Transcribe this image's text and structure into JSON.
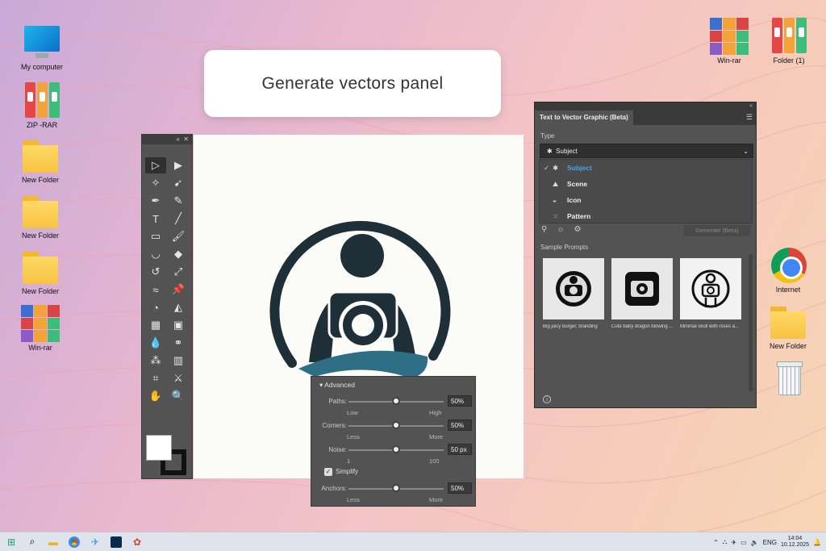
{
  "callout": {
    "text": "Generate vectors panel"
  },
  "desktop": {
    "my_computer": "My computer",
    "zip_rar": "ZIP -RAR",
    "new_folder_1": "New Folder",
    "new_folder_2": "New Folder",
    "new_folder_3": "New Folder",
    "winrar_left": "Win-rar",
    "winrar_right": "Win-rar",
    "folder_1": "Folder (1)",
    "internet": "Internet",
    "new_folder_right": "New Folder"
  },
  "advanced": {
    "title": "Advanced",
    "paths": {
      "label": "Paths:",
      "value": "50%",
      "low": "Low",
      "high": "High",
      "level": 0.5
    },
    "corners": {
      "label": "Corners:",
      "value": "50%",
      "low": "Less",
      "high": "More",
      "level": 0.5
    },
    "noise": {
      "label": "Noise:",
      "value": "50 px",
      "low": "1",
      "high": "100",
      "level": 0.5
    },
    "simplify": {
      "label": "Simplify",
      "checked": true
    },
    "anchors": {
      "label": "Anchors:",
      "value": "50%",
      "low": "Less",
      "high": "More",
      "level": 0.5
    }
  },
  "ttv": {
    "tab": "Text to Vector Graphic (Beta)",
    "type_label": "Type",
    "selected": "Subject",
    "options": [
      "Subject",
      "Scene",
      "Icon",
      "Pattern"
    ],
    "generate": "Generate (Beta)",
    "sample_label": "Sample Prompts",
    "samples": [
      "Big juicy burger, branding",
      "Cute baby dragon blowing ...",
      "Minimal skull with roses a..."
    ]
  },
  "taskbar": {
    "lang": "ENG",
    "time": "14:04",
    "date": "10.12.2025"
  },
  "colors": {
    "accent": "#4aa3f0",
    "logo_dark": "#1f2f38",
    "logo_teal": "#2f6f86"
  }
}
